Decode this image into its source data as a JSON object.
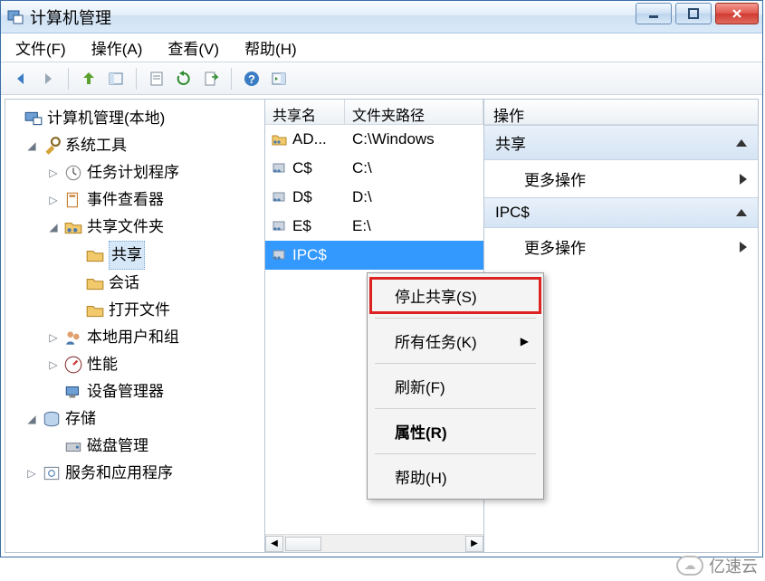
{
  "window": {
    "title": "计算机管理"
  },
  "menu": {
    "file": "文件(F)",
    "action": "操作(A)",
    "view": "查看(V)",
    "help": "帮助(H)"
  },
  "tree": {
    "root": "计算机管理(本地)",
    "systools": "系统工具",
    "scheduler": "任务计划程序",
    "event": "事件查看器",
    "shared_folders": "共享文件夹",
    "shares": "共享",
    "sessions": "会话",
    "open_files": "打开文件",
    "local_users": "本地用户和组",
    "performance": "性能",
    "device_mgr": "设备管理器",
    "storage": "存储",
    "disk_mgmt": "磁盘管理",
    "services_apps": "服务和应用程序"
  },
  "list": {
    "col_name": "共享名",
    "col_path": "文件夹路径",
    "rows": [
      {
        "name": "AD...",
        "path": "C:\\Windows"
      },
      {
        "name": "C$",
        "path": "C:\\"
      },
      {
        "name": "D$",
        "path": "D:\\"
      },
      {
        "name": "E$",
        "path": "E:\\"
      },
      {
        "name": "IPC$",
        "path": ""
      }
    ]
  },
  "actions": {
    "header": "操作",
    "section1": "共享",
    "more1": "更多操作",
    "section2": "IPC$",
    "more2": "更多操作"
  },
  "context_menu": {
    "stop_sharing": "停止共享(S)",
    "all_tasks": "所有任务(K)",
    "refresh": "刷新(F)",
    "properties": "属性(R)",
    "help": "帮助(H)"
  },
  "watermark": "亿速云"
}
